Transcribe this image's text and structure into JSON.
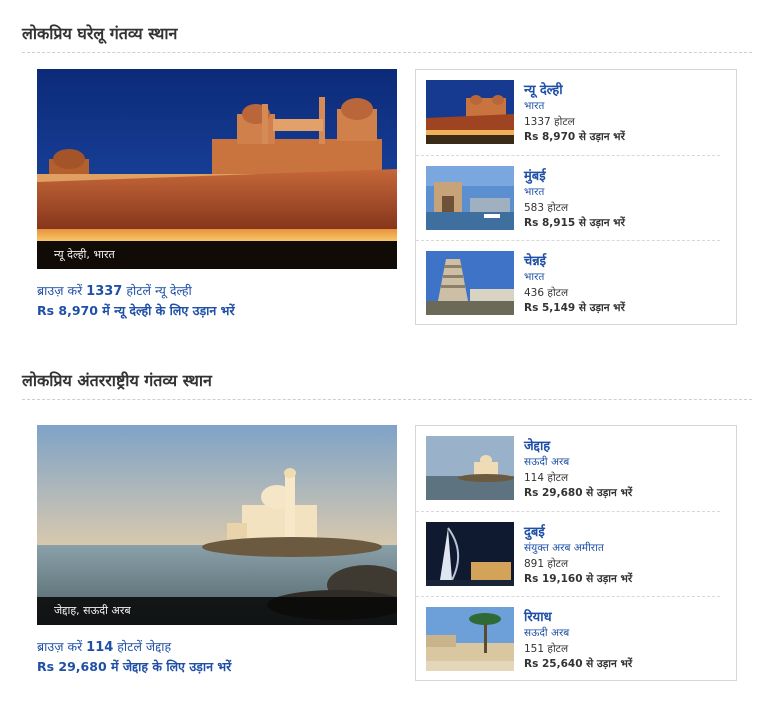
{
  "domestic": {
    "title": "लोकप्रिय घरेलू गंतव्य स्थान",
    "feature": {
      "caption": "न्यू देल्ही, भारत",
      "browse_prefix": "ब्राउज़ करें",
      "browse_count": "1337",
      "browse_suffix": "होटलें न्यू देल्ही",
      "fare_text": "Rs 8,970 में न्यू देल्ही के लिए उड़ान भरें"
    },
    "items": [
      {
        "name": "न्यू देल्ही",
        "country": "भारत",
        "hotels": "1337 होटल",
        "fare": "Rs 8,970 से उड़ान भरें"
      },
      {
        "name": "मुंबई",
        "country": "भारत",
        "hotels": "583 होटल",
        "fare": "Rs 8,915 से उड़ान भरें"
      },
      {
        "name": "चेन्नई",
        "country": "भारत",
        "hotels": "436 होटल",
        "fare": "Rs 5,149 से उड़ान भरें"
      }
    ]
  },
  "international": {
    "title": "लोकप्रिय अंतरराष्ट्रीय गंतव्य स्थान",
    "feature": {
      "caption": "जेद्दाह, सऊदी अरब",
      "browse_prefix": "ब्राउज़ करें",
      "browse_count": "114",
      "browse_suffix": "होटलें जेद्दाह",
      "fare_text": "Rs 29,680 में जेद्दाह के लिए उड़ान भरें"
    },
    "items": [
      {
        "name": "जेद्दाह",
        "country": "सऊदी अरब",
        "hotels": "114 होटल",
        "fare": "Rs 29,680 से उड़ान भरें"
      },
      {
        "name": "दुबई",
        "country": "संयुक्त अरब अमीरात",
        "hotels": "891 होटल",
        "fare": "Rs 19,160 से उड़ान भरें"
      },
      {
        "name": "रियाध",
        "country": "सऊदी अरब",
        "hotels": "151 होटल",
        "fare": "Rs 25,640 से उड़ान भरें"
      }
    ]
  },
  "colors": {
    "link": "#1f4fa6",
    "text": "#333333",
    "border": "#d6d6d6"
  }
}
